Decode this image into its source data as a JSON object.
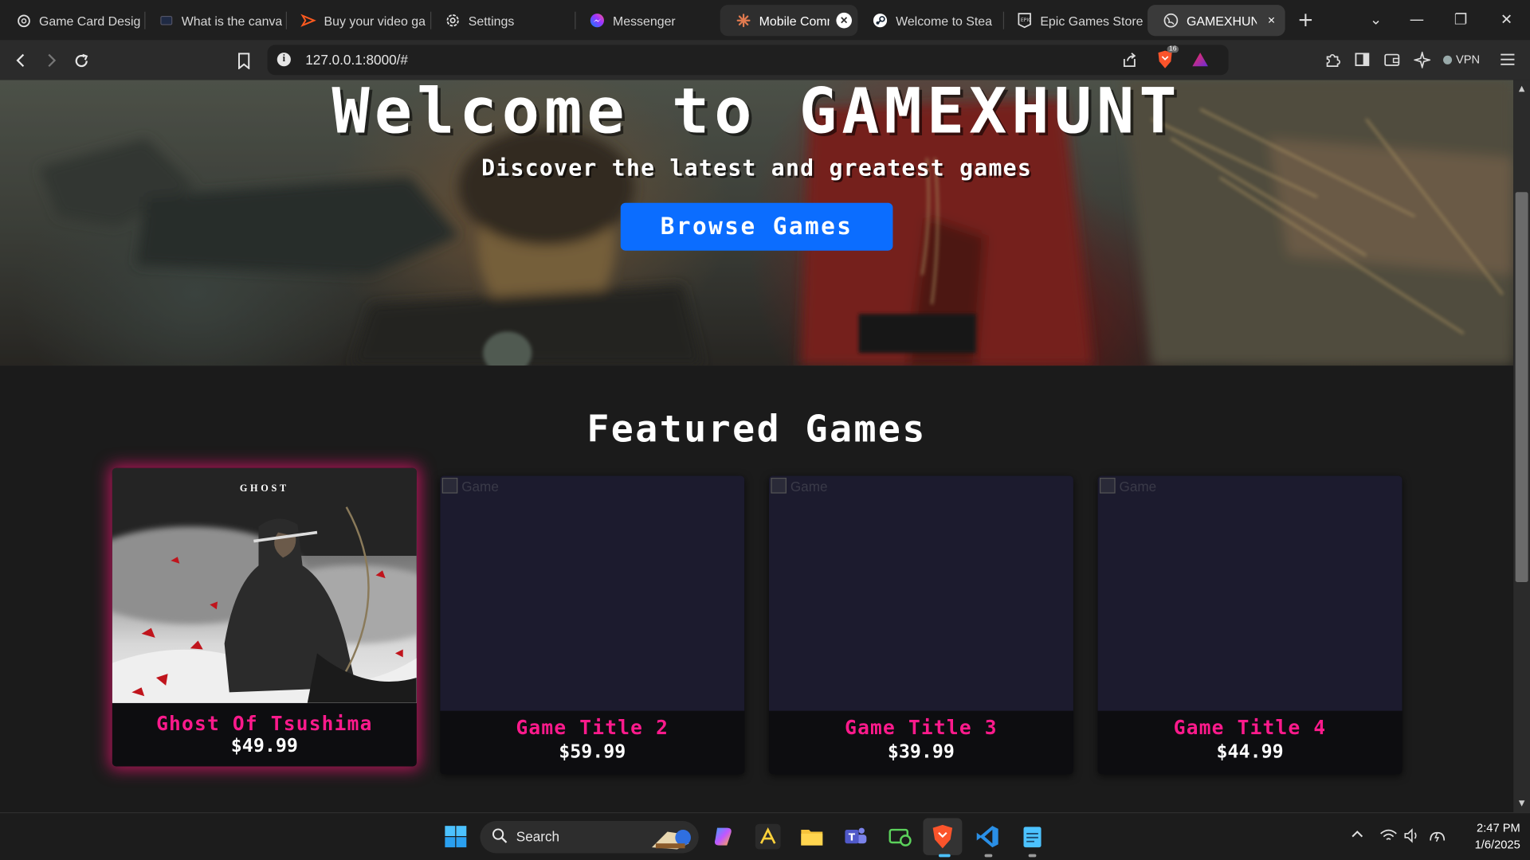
{
  "browser": {
    "tabs": [
      {
        "title": "Game Card Desig",
        "icon": "chatgpt-icon"
      },
      {
        "title": "What is the canva",
        "icon": "chat-icon"
      },
      {
        "title": "Buy your video ga",
        "icon": "store-icon"
      },
      {
        "title": "Settings",
        "icon": "gear-icon"
      },
      {
        "title": "Messenger",
        "icon": "messenger-icon"
      },
      {
        "title": "Mobile Comm",
        "icon": "claude-icon",
        "close": "×"
      },
      {
        "title": "Welcome to Stea",
        "icon": "steam-icon"
      },
      {
        "title": "Epic Games Store",
        "icon": "epic-icon"
      },
      {
        "title": "GAMEXHUNT",
        "icon": "globe-icon",
        "active": true,
        "close": "×"
      }
    ],
    "new_tab": "+",
    "tab_list": "⌄",
    "window_controls": {
      "minimize": "—",
      "restore": "❐",
      "close": "✕"
    },
    "address": "127.0.0.1:8000/#",
    "shields_count": "16",
    "vpn_label": "VPN"
  },
  "page": {
    "hero": {
      "title": "Welcome to GAMEXHUNT",
      "subtitle": "Discover the latest and greatest games",
      "cta": "Browse Games"
    },
    "featured": {
      "heading": "Featured Games",
      "games": [
        {
          "title": "Ghost Of Tsushima",
          "price": "$49.99",
          "image_alt": "",
          "logo": "GHOST"
        },
        {
          "title": "Game Title 2",
          "price": "$59.99",
          "image_alt": "Game"
        },
        {
          "title": "Game Title 3",
          "price": "$39.99",
          "image_alt": "Game"
        },
        {
          "title": "Game Title 4",
          "price": "$44.99",
          "image_alt": "Game"
        }
      ]
    }
  },
  "taskbar": {
    "search_placeholder": "Search",
    "time": "2:47 PM",
    "date": "1/6/2025"
  },
  "colors": {
    "accent_blue": "#0b6dff",
    "title_pink": "#ff1a8c",
    "card_bg": "#1c1b2e",
    "page_bg": "#1b1b1b"
  }
}
